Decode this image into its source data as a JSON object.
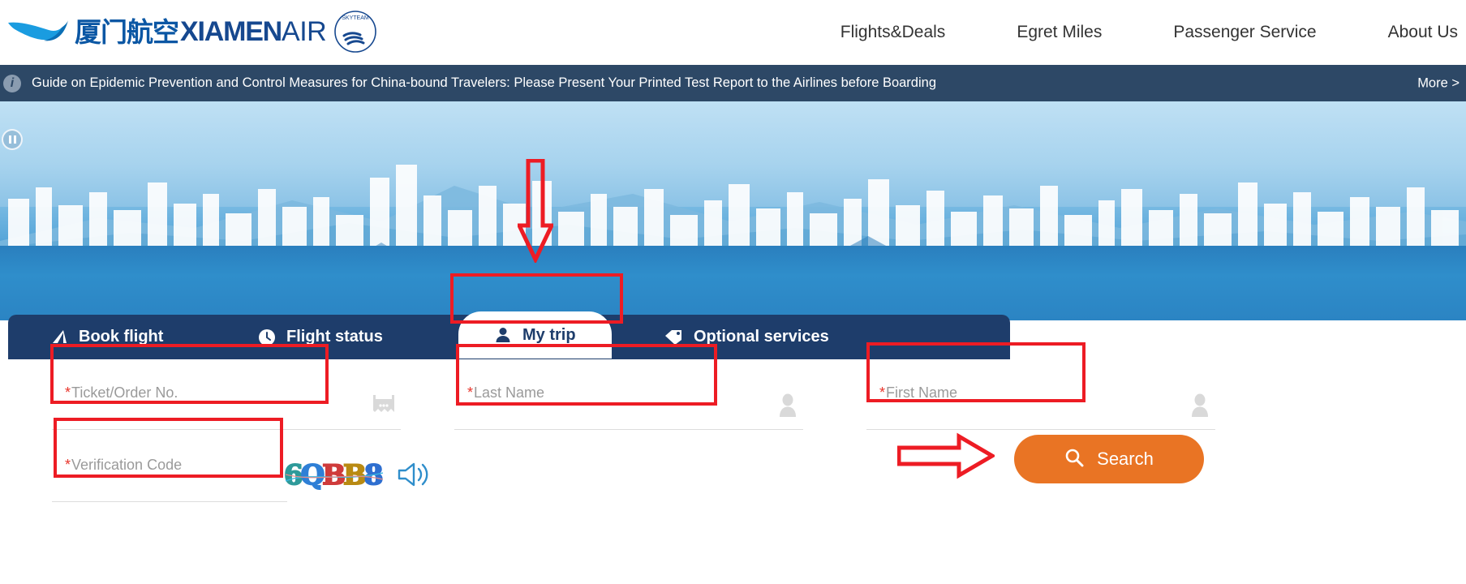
{
  "brand": {
    "logo_cn": "厦门航空",
    "logo_xiamen": "XIAMEN",
    "logo_air": "AIR",
    "alliance": "SkyTeam",
    "primary_color": "#16488f",
    "accent_color": "#e97424"
  },
  "nav": {
    "items": [
      {
        "label": "Flights&Deals"
      },
      {
        "label": "Egret Miles"
      },
      {
        "label": "Passenger Service"
      },
      {
        "label": "About Us"
      }
    ]
  },
  "notice": {
    "icon": "info-icon",
    "text": "Guide on Epidemic Prevention and Control Measures for China-bound Travelers: Please Present Your Printed Test Report to the Airlines before Boarding",
    "more_label": "More >",
    "background_color": "#2d4866"
  },
  "hero": {
    "pause_label": "Pause",
    "carousel_icon": "pause-icon"
  },
  "tabs": [
    {
      "label": "Book flight",
      "icon": "airplane-wing-icon",
      "active": false
    },
    {
      "label": "Flight status",
      "icon": "clock-icon",
      "active": false
    },
    {
      "label": "My trip",
      "icon": "person-icon",
      "active": true
    },
    {
      "label": "Optional services",
      "icon": "tag-icon",
      "active": false
    }
  ],
  "form": {
    "fields": [
      {
        "name": "ticket-order-no",
        "required_mark": "*",
        "placeholder": "Ticket/Order No.",
        "value": "",
        "icon": "ticket-icon"
      },
      {
        "name": "last-name",
        "required_mark": "*",
        "placeholder": "Last Name",
        "value": "",
        "icon": "person-icon"
      },
      {
        "name": "first-name",
        "required_mark": "*",
        "placeholder": "First Name",
        "value": "",
        "icon": "person-icon"
      },
      {
        "name": "verification-code",
        "required_mark": "*",
        "placeholder": "Verification Code",
        "value": "",
        "icon": ""
      }
    ],
    "captcha": {
      "characters": [
        {
          "char": "6",
          "color": "#2e9a9a"
        },
        {
          "char": "Q",
          "color": "#2f7fd6"
        },
        {
          "char": "B",
          "color": "#cf3b3b"
        },
        {
          "char": "B",
          "color": "#b98a12"
        },
        {
          "char": "8",
          "color": "#2f6fd0"
        }
      ],
      "audio_icon": "speaker-icon"
    },
    "search_button": {
      "label": "Search",
      "icon": "search-icon",
      "color": "#e97424"
    }
  },
  "annotations": {
    "down_arrow": "red-down-arrow",
    "right_arrow": "red-right-arrow",
    "highlight_color": "#ed1c24",
    "boxes": [
      "my-trip-tab",
      "ticket-order-no",
      "last-name",
      "first-name",
      "verification-code"
    ]
  }
}
